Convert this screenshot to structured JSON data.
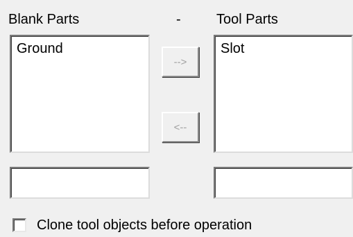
{
  "blank_parts": {
    "label": "Blank Parts",
    "items": [
      "Ground"
    ],
    "filter_value": ""
  },
  "separator_label": "-",
  "tool_parts": {
    "label": "Tool Parts",
    "items": [
      "Slot"
    ],
    "filter_value": ""
  },
  "buttons": {
    "move_right_label": "-->",
    "move_left_label": "<--"
  },
  "clone_option": {
    "label": "Clone tool objects before operation",
    "checked": false
  },
  "colors": {
    "background": "#f0f0f0",
    "list_background": "#ffffff",
    "disabled_text": "#a0a0a0"
  }
}
